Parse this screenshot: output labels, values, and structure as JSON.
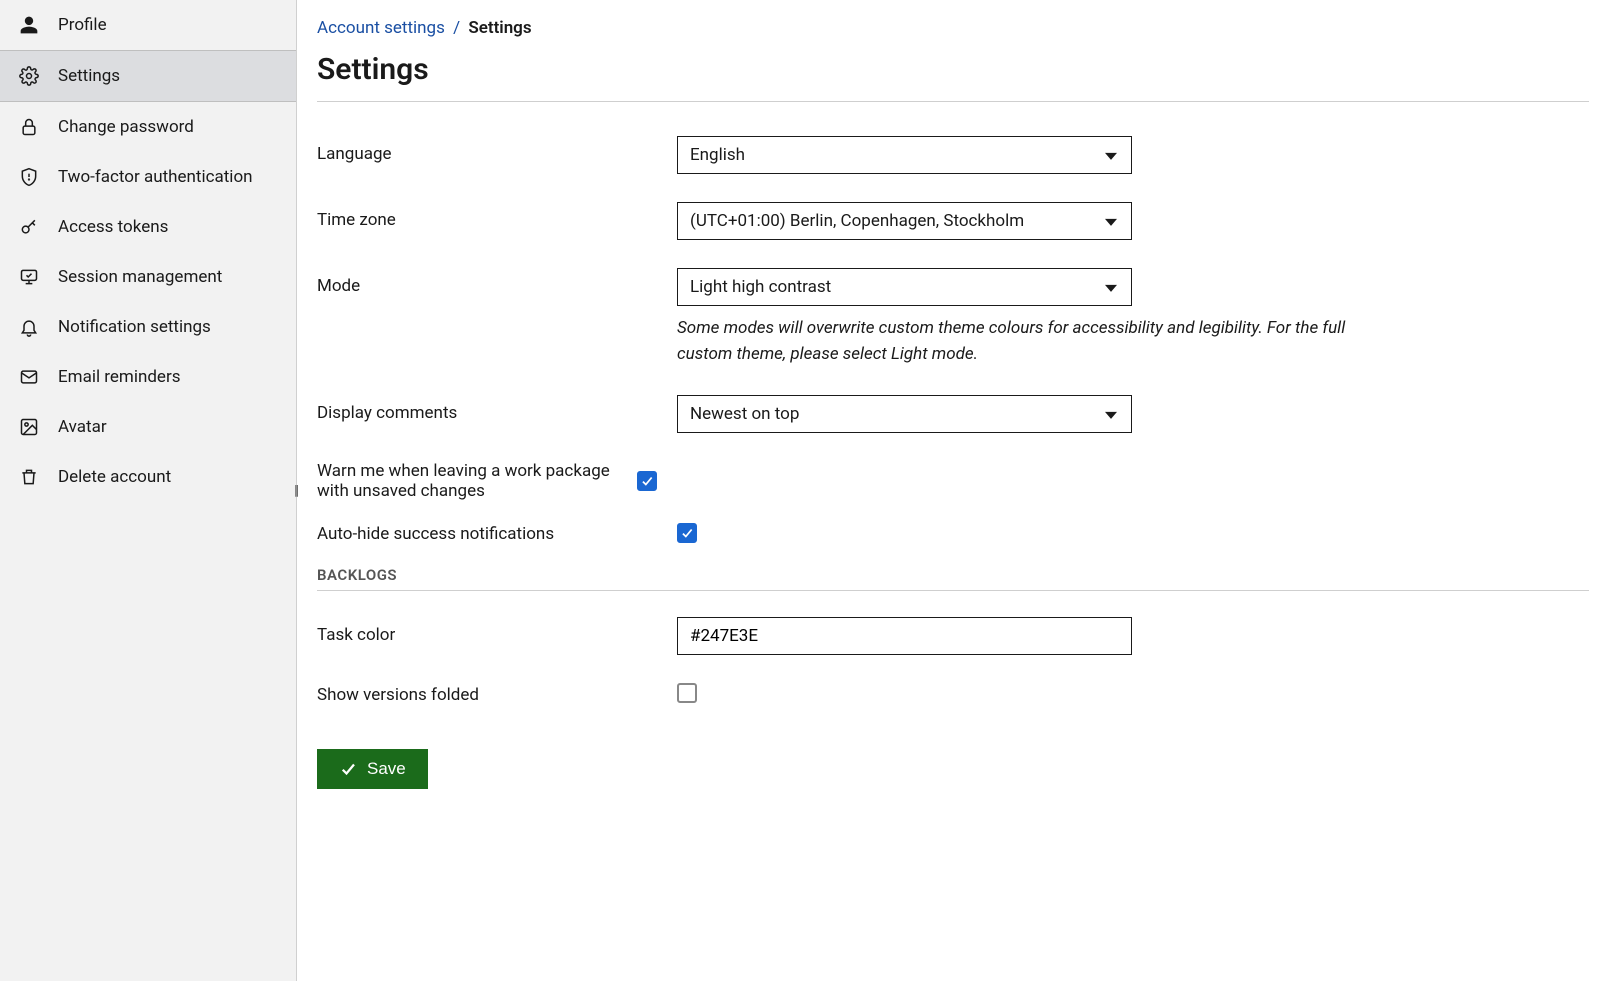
{
  "sidebar": {
    "items": [
      {
        "label": "Profile"
      },
      {
        "label": "Settings"
      },
      {
        "label": "Change password"
      },
      {
        "label": "Two-factor authentication"
      },
      {
        "label": "Access tokens"
      },
      {
        "label": "Session management"
      },
      {
        "label": "Notification settings"
      },
      {
        "label": "Email reminders"
      },
      {
        "label": "Avatar"
      },
      {
        "label": "Delete account"
      }
    ]
  },
  "breadcrumb": {
    "parent": "Account settings",
    "separator": "/",
    "current": "Settings"
  },
  "page_title": "Settings",
  "form": {
    "language": {
      "label": "Language",
      "value": "English"
    },
    "timezone": {
      "label": "Time zone",
      "value": "(UTC+01:00) Berlin, Copenhagen, Stockholm"
    },
    "mode": {
      "label": "Mode",
      "value": "Light high contrast",
      "hint": "Some modes will overwrite custom theme colours for accessibility and legibility. For the full custom theme, please select Light mode."
    },
    "display_comments": {
      "label": "Display comments",
      "value": "Newest on top"
    },
    "warn_unsaved": {
      "label": "Warn me when leaving a work package with unsaved changes",
      "checked": true
    },
    "auto_hide": {
      "label": "Auto-hide success notifications",
      "checked": true
    }
  },
  "backlogs": {
    "heading": "BACKLOGS",
    "task_color": {
      "label": "Task color",
      "value": "#247E3E"
    },
    "versions_folded": {
      "label": "Show versions folded",
      "checked": false
    }
  },
  "save_label": "Save"
}
